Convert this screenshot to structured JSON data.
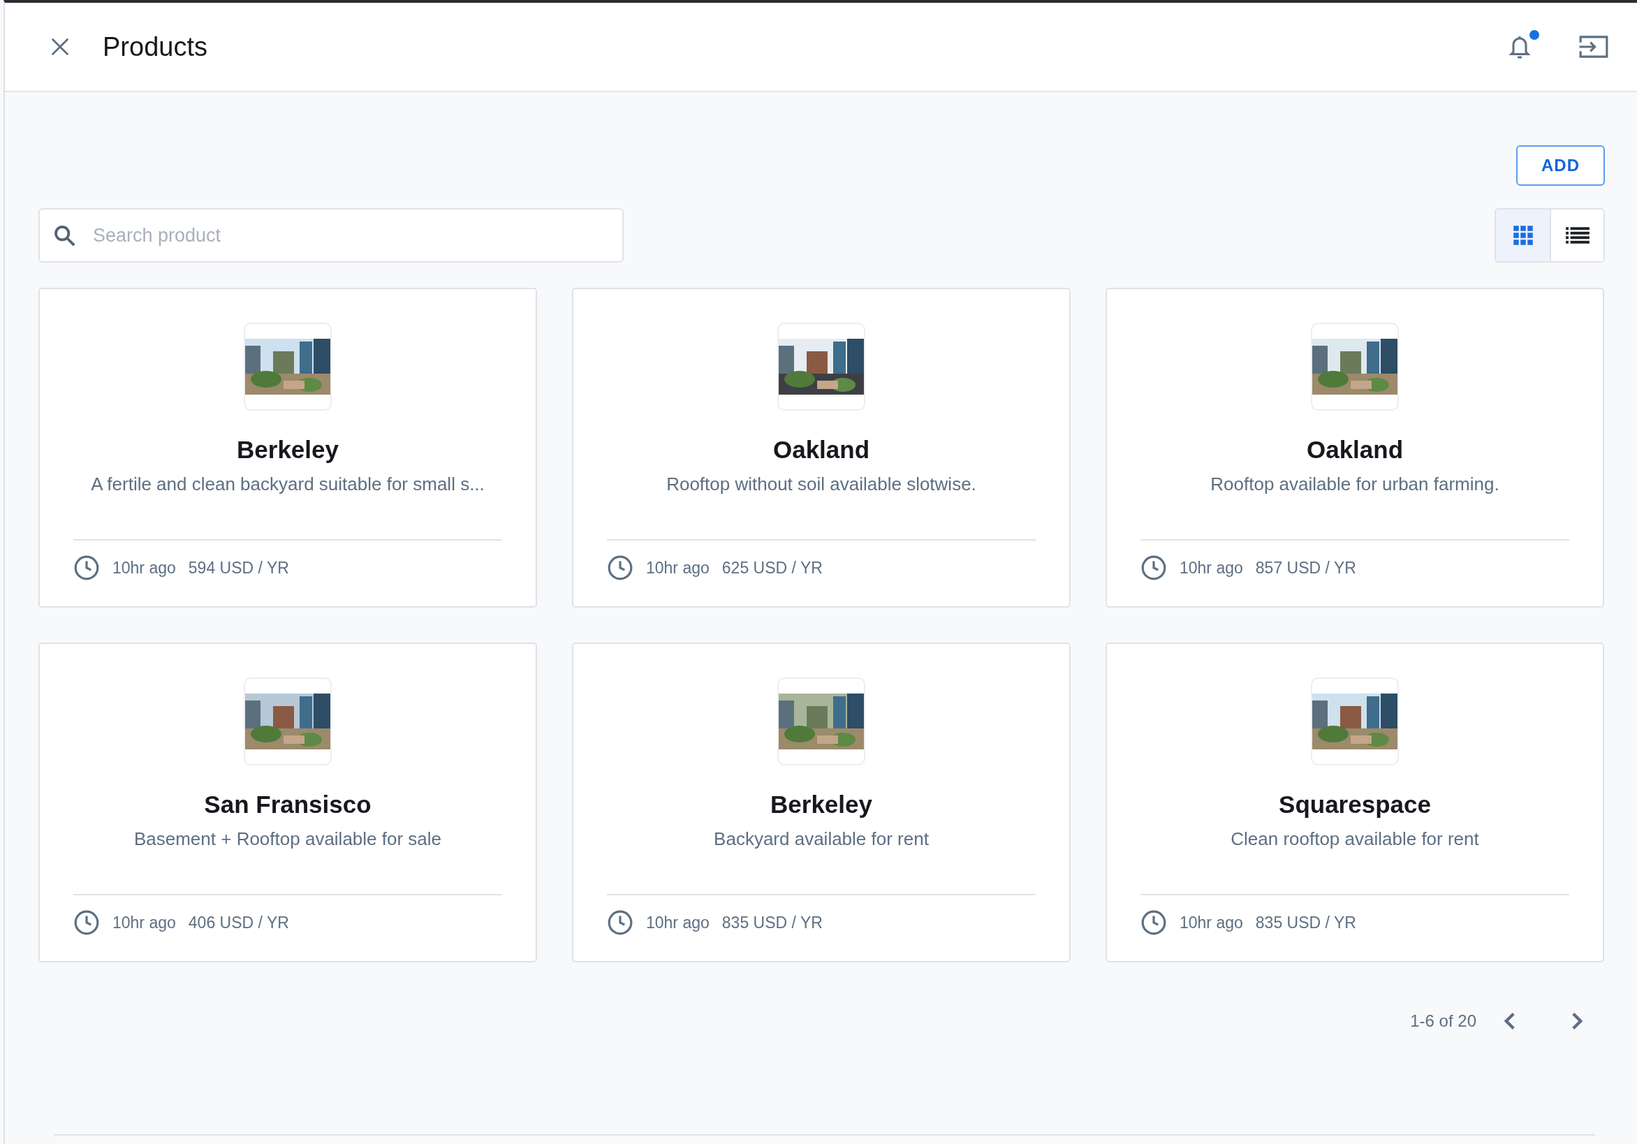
{
  "header": {
    "title": "Products",
    "notifications_unread": true
  },
  "add_button": "ADD",
  "search": {
    "placeholder": "Search product"
  },
  "view_modes": [
    {
      "kind": "grid",
      "selected": true
    },
    {
      "kind": "list",
      "selected": false
    }
  ],
  "products": [
    {
      "name": "Berkeley",
      "description": "A fertile and clean backyard suitable for small s...",
      "time": "10hr ago",
      "price": "594 USD / YR"
    },
    {
      "name": "Oakland",
      "description": "Rooftop without soil available slotwise.",
      "time": "10hr ago",
      "price": "625 USD / YR"
    },
    {
      "name": "Oakland",
      "description": "Rooftop available for urban farming.",
      "time": "10hr ago",
      "price": "857 USD / YR"
    },
    {
      "name": "San Fransisco",
      "description": "Basement + Rooftop available for sale",
      "time": "10hr ago",
      "price": "406 USD / YR"
    },
    {
      "name": "Berkeley",
      "description": "Backyard available for rent",
      "time": "10hr ago",
      "price": "835 USD / YR"
    },
    {
      "name": "Squarespace",
      "description": "Clean rooftop available for rent",
      "time": "10hr ago",
      "price": "835 USD / YR"
    }
  ],
  "pagination": {
    "range": "1-6 of 20"
  }
}
